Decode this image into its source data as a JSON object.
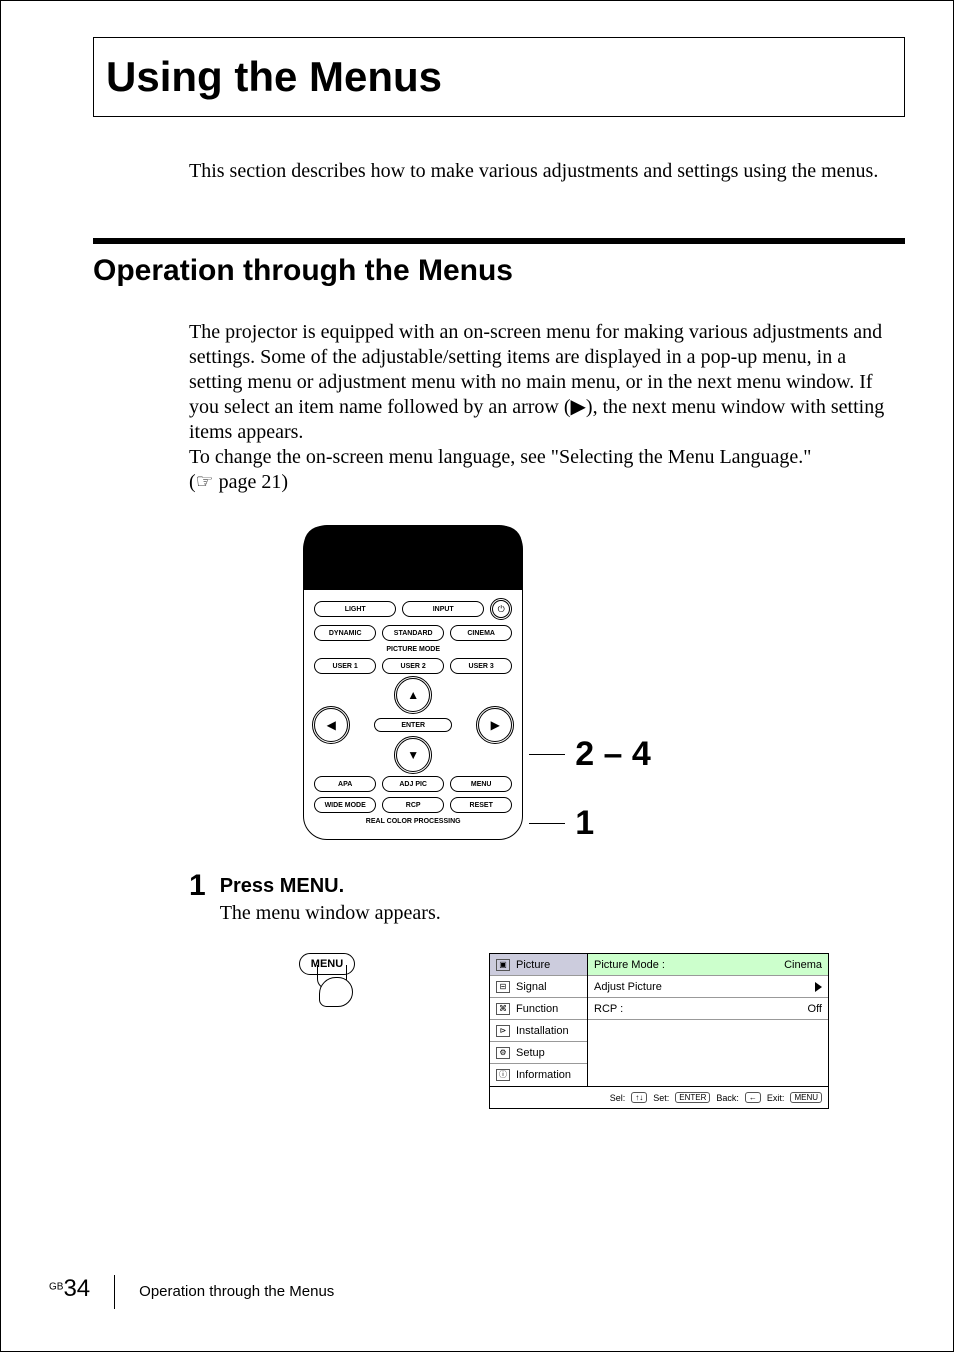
{
  "title": "Using the Menus",
  "intro": "This section describes how to make various adjustments and settings using the menus.",
  "section_heading": "Operation through the Menus",
  "body_para1": "The projector is equipped with an on-screen menu for making various adjustments and settings. Some of the adjustable/setting items are displayed in a pop-up menu, in a setting menu or adjustment menu with no main menu, or in the next menu window.  If you select an item name followed by an arrow (▶), the next menu window with setting items appears.",
  "body_para2": "To change the  on-screen menu language, see \"Selecting the Menu Language.\"",
  "page_ref": "page 21",
  "remote": {
    "row1": {
      "light": "LIGHT",
      "input": "INPUT",
      "power": "⏻"
    },
    "row2": {
      "dynamic": "DYNAMIC",
      "standard": "STANDARD",
      "cinema": "CINEMA"
    },
    "picture_mode_label": "PICTURE MODE",
    "row3": {
      "user1": "USER 1",
      "user2": "USER 2",
      "user3": "USER 3"
    },
    "enter": "ENTER",
    "row4": {
      "apa": "APA",
      "adjpic": "ADJ PIC",
      "menu": "MENU"
    },
    "row5": {
      "widemode": "WIDE MODE",
      "rcp": "RCP",
      "reset": "RESET"
    },
    "rcp_label": "REAL COLOR PROCESSING"
  },
  "callouts": {
    "nav": "2 – 4",
    "menu": "1"
  },
  "step1": {
    "num": "1",
    "title": "Press MENU.",
    "text": "The menu window appears."
  },
  "menu_button_label": "MENU",
  "osd": {
    "left": [
      "Picture",
      "Signal",
      "Function",
      "Installation",
      "Setup",
      "Information"
    ],
    "left_icons": [
      "▣",
      "⊟",
      "⌘",
      "⊳",
      "⚙",
      "ⓘ"
    ],
    "right": {
      "picture_mode_label": "Picture Mode :",
      "picture_mode_value": "Cinema",
      "adjust_picture": "Adjust Picture",
      "rcp_label": "RCP :",
      "rcp_value": "Off"
    },
    "footer": {
      "sel": "Sel:",
      "set": "Set:",
      "back": "Back:",
      "exit": "Exit:",
      "enter_key": "ENTER",
      "menu_key": "MENU"
    }
  },
  "footer": {
    "gb": "GB",
    "page_num": "34",
    "section": "Operation through the Menus"
  }
}
